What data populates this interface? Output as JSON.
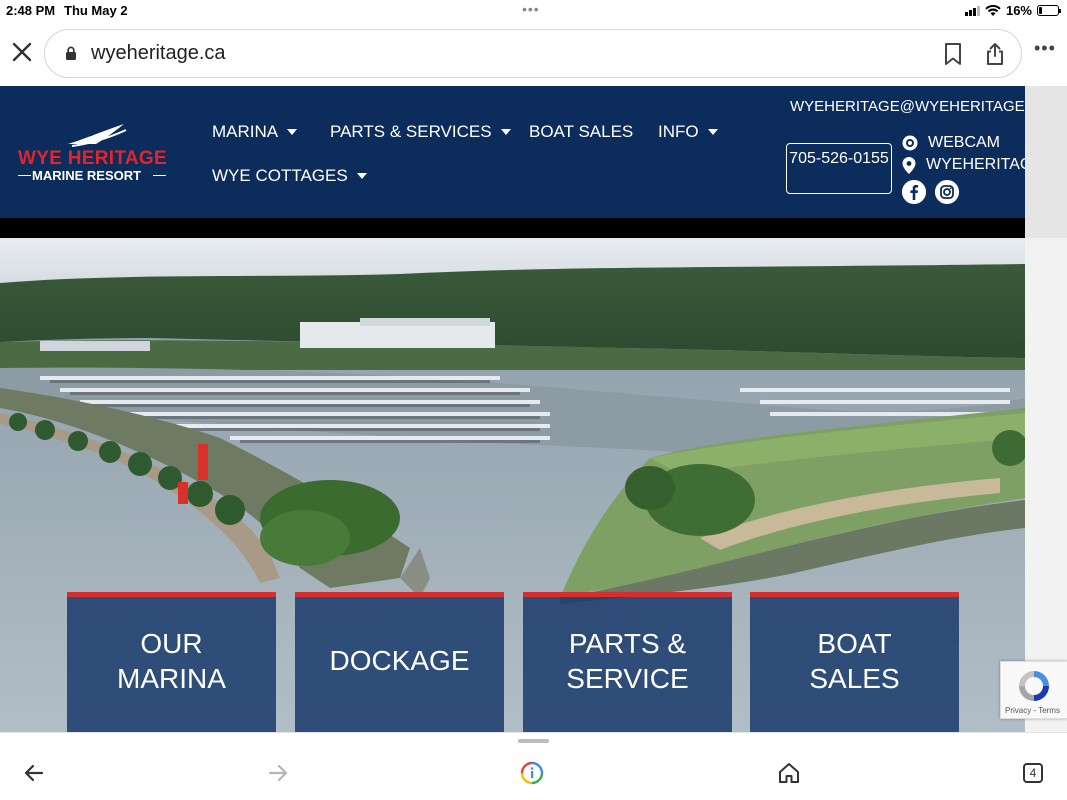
{
  "status_bar": {
    "time": "2:48 PM",
    "date": "Thu May 2",
    "battery": "16%",
    "battery_level": 0.16
  },
  "browser": {
    "url": "wyeheritage.ca",
    "tab_count": "4"
  },
  "logo": {
    "line1": "WYE HERITAGE",
    "line2": "MARINE RESORT"
  },
  "nav": {
    "items": [
      {
        "label": "MARINA",
        "has_dropdown": true
      },
      {
        "label": "PARTS & SERVICES",
        "has_dropdown": true
      },
      {
        "label": "BOAT SALES",
        "has_dropdown": false
      },
      {
        "label": "INFO",
        "has_dropdown": true
      },
      {
        "label": "WYE COTTAGES",
        "has_dropdown": true
      }
    ]
  },
  "contact": {
    "email": "WYEHERITAGE@WYEHERITAGE.CA",
    "phone": "705-526-0155",
    "webcam": "WEBCAM",
    "location": "WYEHERITAGE"
  },
  "tiles": [
    {
      "label": "OUR MARINA"
    },
    {
      "label": "DOCKAGE"
    },
    {
      "label": "PARTS & SERVICE"
    },
    {
      "label": "BOAT SALES"
    }
  ],
  "recaptcha": {
    "text": "Privacy - Terms"
  },
  "colors": {
    "header_bg": "#0c2d5b",
    "accent_red": "#e2242b",
    "tile_bg": "#1c3d6d"
  },
  "icons": [
    "close-icon",
    "lock-icon",
    "bookmark-icon",
    "share-icon",
    "more-icon",
    "webcam-icon",
    "location-pin-icon",
    "facebook-icon",
    "instagram-icon",
    "back-icon",
    "forward-icon",
    "assistant-icon",
    "home-icon",
    "tabs-icon"
  ]
}
